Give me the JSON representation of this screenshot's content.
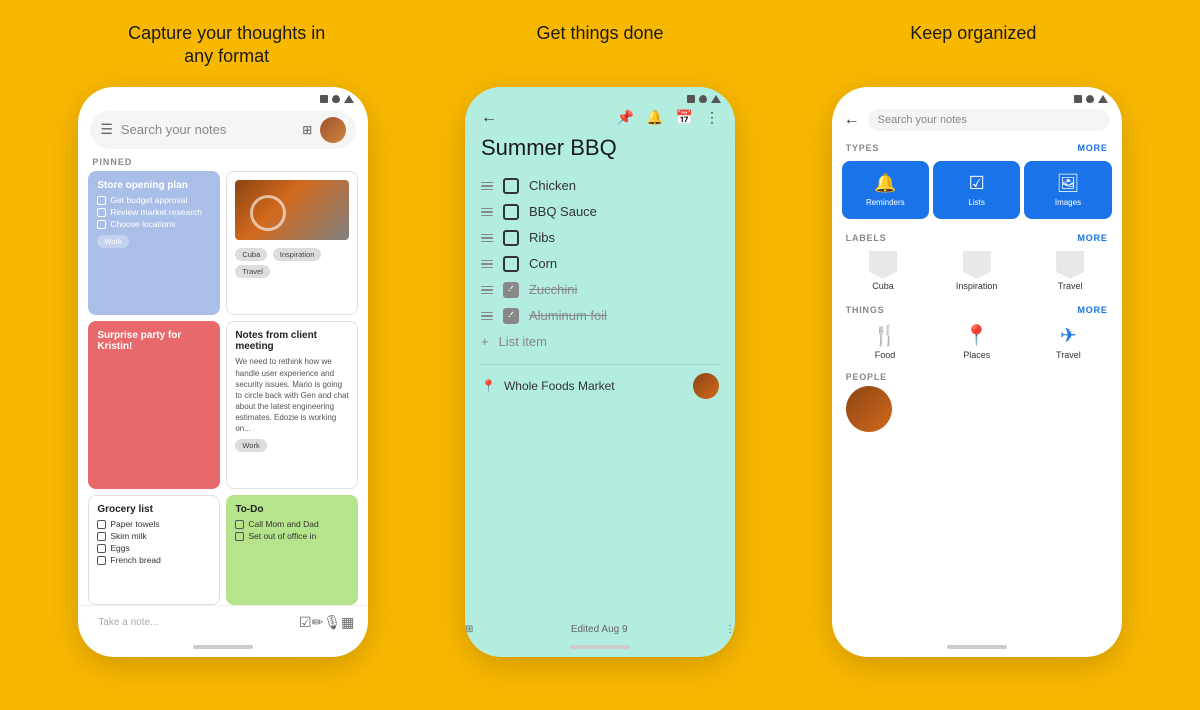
{
  "headings": {
    "left": "Capture your thoughts in\nany format",
    "center": "Get things done",
    "right": "Keep organized"
  },
  "phone1": {
    "search_placeholder": "Search your notes",
    "pinned_label": "PINNED",
    "notes": [
      {
        "id": "store-opening",
        "color": "blue",
        "title": "Store opening plan",
        "items": [
          "Get budget approval",
          "Review market research",
          "Choose locations"
        ],
        "tags": [
          "Work"
        ]
      },
      {
        "id": "car-photo",
        "color": "white",
        "has_image": true,
        "tags": [
          "Cuba",
          "Inspiration",
          "Travel"
        ]
      },
      {
        "id": "surprise-party",
        "color": "red",
        "title": "Surprise party for Kristin!"
      },
      {
        "id": "client-meeting",
        "color": "white",
        "title": "Notes from client meeting",
        "body": "We need to rethink how we handle user experience and security issues. Mario is going to circle back with Gen and chat about the latest engineering estimates. Edozie is working on...",
        "tags": [
          "Work"
        ]
      },
      {
        "id": "grocery-list",
        "color": "white",
        "title": "Grocery list",
        "items": [
          "Paper towels",
          "Skim milk",
          "Eggs",
          "French bread"
        ]
      },
      {
        "id": "todo",
        "color": "green",
        "title": "To-Do",
        "items": [
          "Call Mom and Dad",
          "Set out of office in"
        ]
      }
    ],
    "bottom": {
      "take_note": "Take a note...",
      "icons": [
        "☑",
        "✏",
        "🎙",
        "▦"
      ]
    }
  },
  "phone2": {
    "title": "Summer BBQ",
    "items": [
      {
        "text": "Chicken",
        "done": false
      },
      {
        "text": "BBQ Sauce",
        "done": false
      },
      {
        "text": "Ribs",
        "done": false
      },
      {
        "text": "Corn",
        "done": false
      },
      {
        "text": "Zucchini",
        "done": true
      },
      {
        "text": "Aluminum foil",
        "done": true
      }
    ],
    "add_item_label": "List item",
    "location": "Whole Foods Market",
    "edited": "Edited Aug 9"
  },
  "phone3": {
    "search_placeholder": "Search your notes",
    "sections": {
      "types": {
        "label": "TYPES",
        "more": "MORE",
        "items": [
          "Reminders",
          "Lists",
          "Images"
        ]
      },
      "labels": {
        "label": "LABELS",
        "more": "MORE",
        "items": [
          "Cuba",
          "Inspiration",
          "Travel"
        ]
      },
      "things": {
        "label": "THINGS",
        "more": "MORE",
        "items": [
          "Food",
          "Places",
          "Travel"
        ]
      },
      "people": {
        "label": "PEOPLE"
      }
    }
  }
}
